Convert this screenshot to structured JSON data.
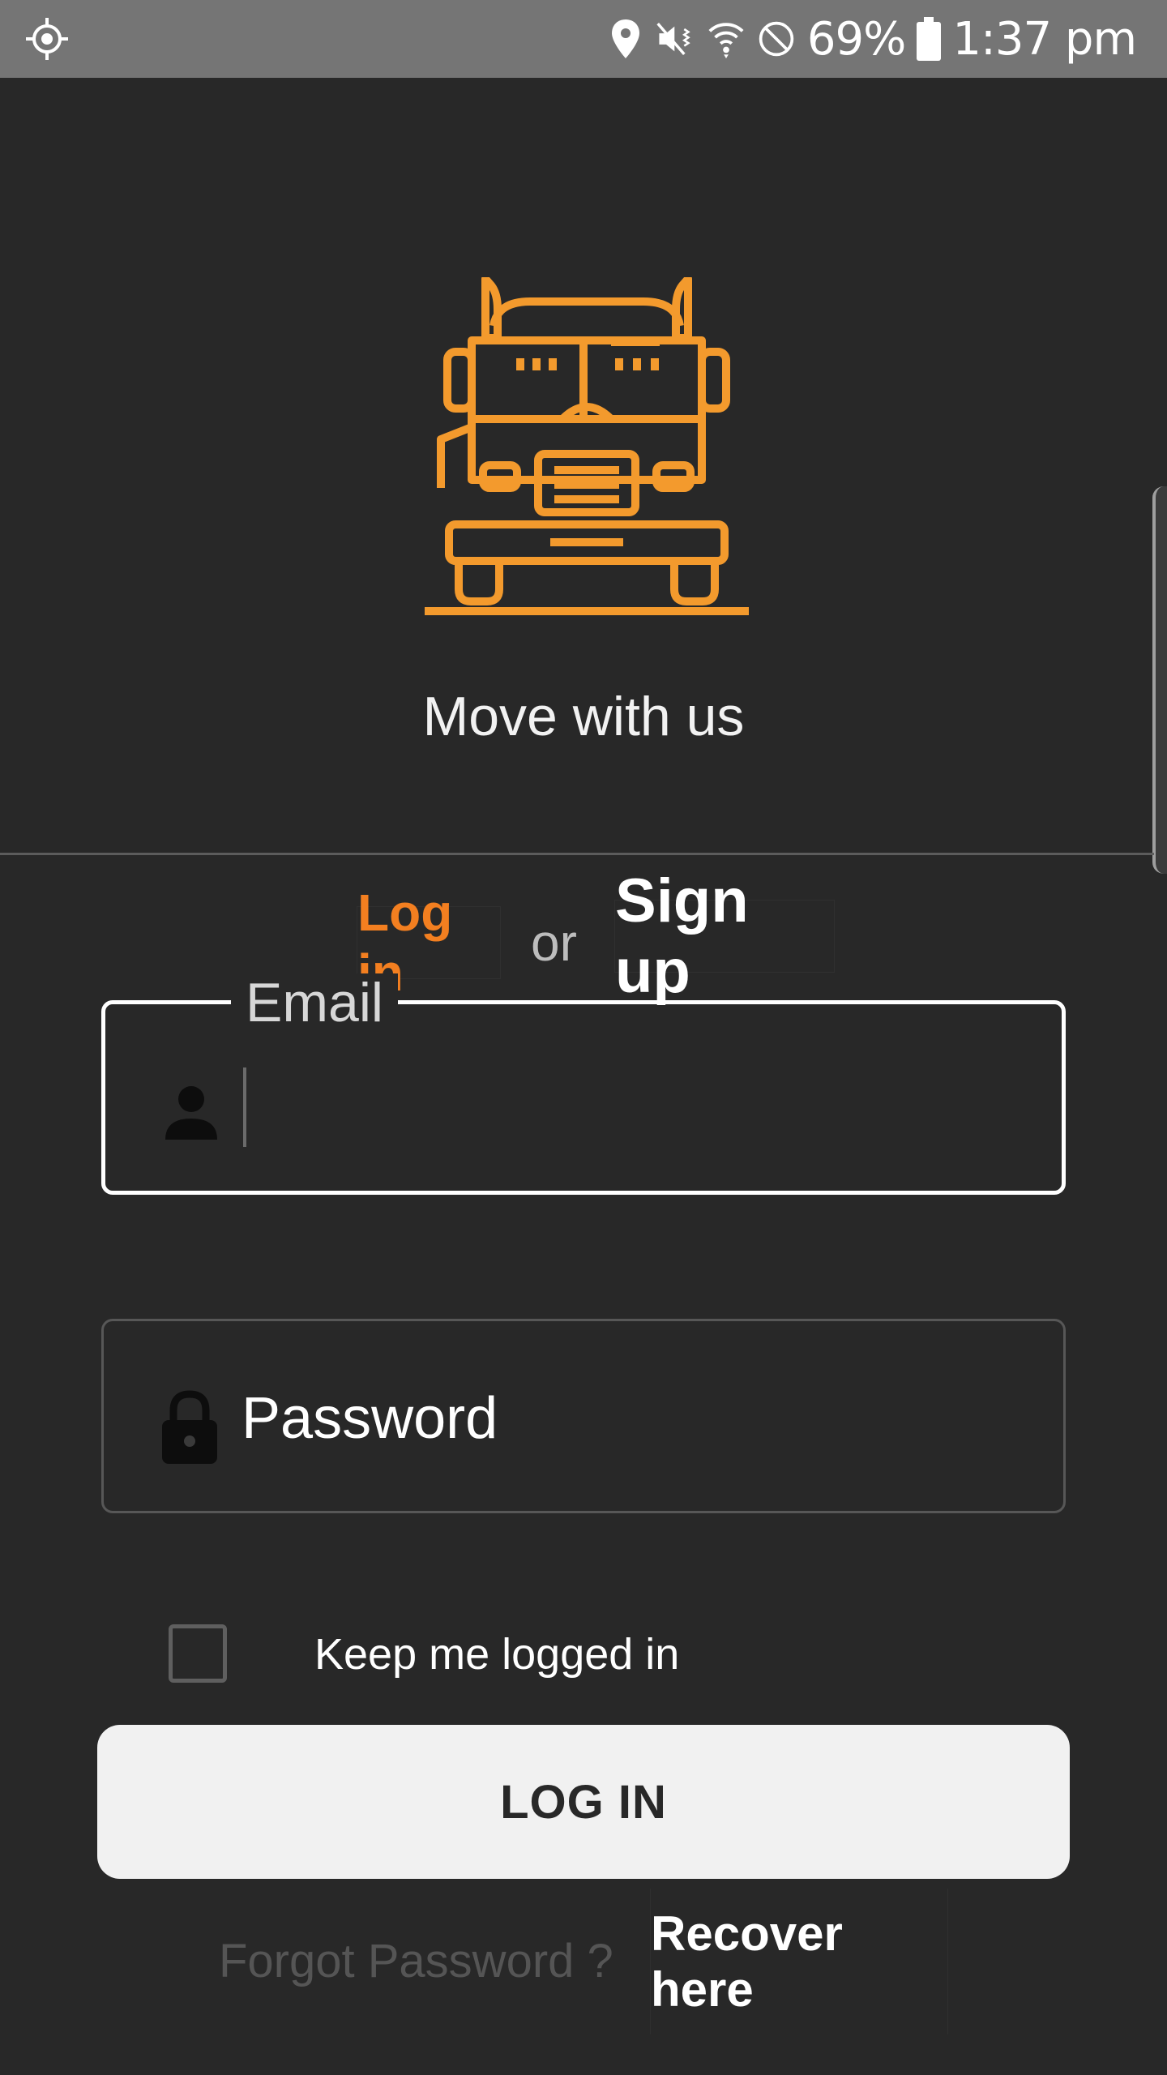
{
  "status_bar": {
    "battery_percent": "69%",
    "time": "1:37 pm",
    "icons": [
      "gps-icon",
      "location-pin-icon",
      "vibrate-mute-icon",
      "wifi-icon",
      "do-not-disturb-icon",
      "battery-icon"
    ]
  },
  "branding": {
    "logo": "truck-icon",
    "tagline": "Move with us",
    "accent_color": "#f39a2d"
  },
  "auth_switch": {
    "login_label": "Log in",
    "or_label": "or",
    "signup_label": "Sign up",
    "active": "login"
  },
  "form": {
    "email": {
      "label": "Email",
      "value": "",
      "icon": "person-icon"
    },
    "password": {
      "placeholder": "Password",
      "icon": "lock-icon"
    },
    "remember": {
      "label": "Keep me logged in",
      "checked": false
    }
  },
  "actions": {
    "login_button": "LOG IN",
    "forgot_text": "Forgot Password ?",
    "recover_link": "Recover here"
  }
}
